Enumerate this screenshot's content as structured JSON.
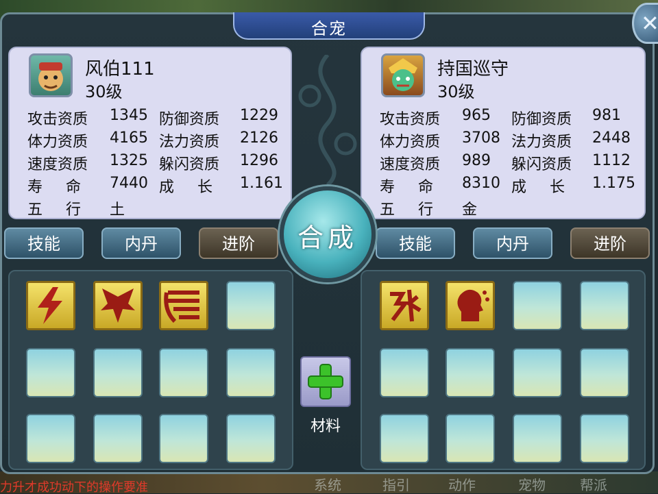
{
  "title": "合宠",
  "close_icon": "close-x",
  "center": {
    "merge_label": "合成",
    "material_label": "材料",
    "material_icon": "green-plus"
  },
  "pets": [
    {
      "name": "风伯111",
      "level": "30级",
      "stats": [
        {
          "l1": "攻击资质",
          "v1": "1345",
          "l2": "防御资质",
          "v2": "1229"
        },
        {
          "l1": "体力资质",
          "v1": "4165",
          "l2": "法力资质",
          "v2": "2126"
        },
        {
          "l1": "速度资质",
          "v1": "1325",
          "l2": "躲闪资质",
          "v2": "1296"
        },
        {
          "l1": "寿　命",
          "v1": "7440",
          "l2": "成　长",
          "v2": "1.161"
        },
        {
          "l1": "五　行",
          "v1": "土"
        }
      ],
      "tabs": [
        "技能",
        "内丹",
        "进阶"
      ],
      "skills": [
        "lightning-skill-icon",
        "eagle-skill-icon",
        "wind-skill-icon"
      ]
    },
    {
      "name": "持国巡守",
      "level": "30级",
      "stats": [
        {
          "l1": "攻击资质",
          "v1": "965",
          "l2": "防御资质",
          "v2": "981"
        },
        {
          "l1": "体力资质",
          "v1": "3708",
          "l2": "法力资质",
          "v2": "2448"
        },
        {
          "l1": "速度资质",
          "v1": "989",
          "l2": "躲闪资质",
          "v2": "1112"
        },
        {
          "l1": "寿　命",
          "v1": "8310",
          "l2": "成　长",
          "v2": "1.175"
        },
        {
          "l1": "五　行",
          "v1": "金"
        }
      ],
      "tabs": [
        "技能",
        "内丹",
        "进阶"
      ],
      "skills": [
        "spirit-rune-skill-icon",
        "mind-skill-icon"
      ]
    }
  ],
  "background": {
    "bottom_nav": [
      "系统",
      "指引",
      "动作",
      "宠物",
      "帮派"
    ],
    "ticker": "力升才成功动下的操作要准"
  }
}
